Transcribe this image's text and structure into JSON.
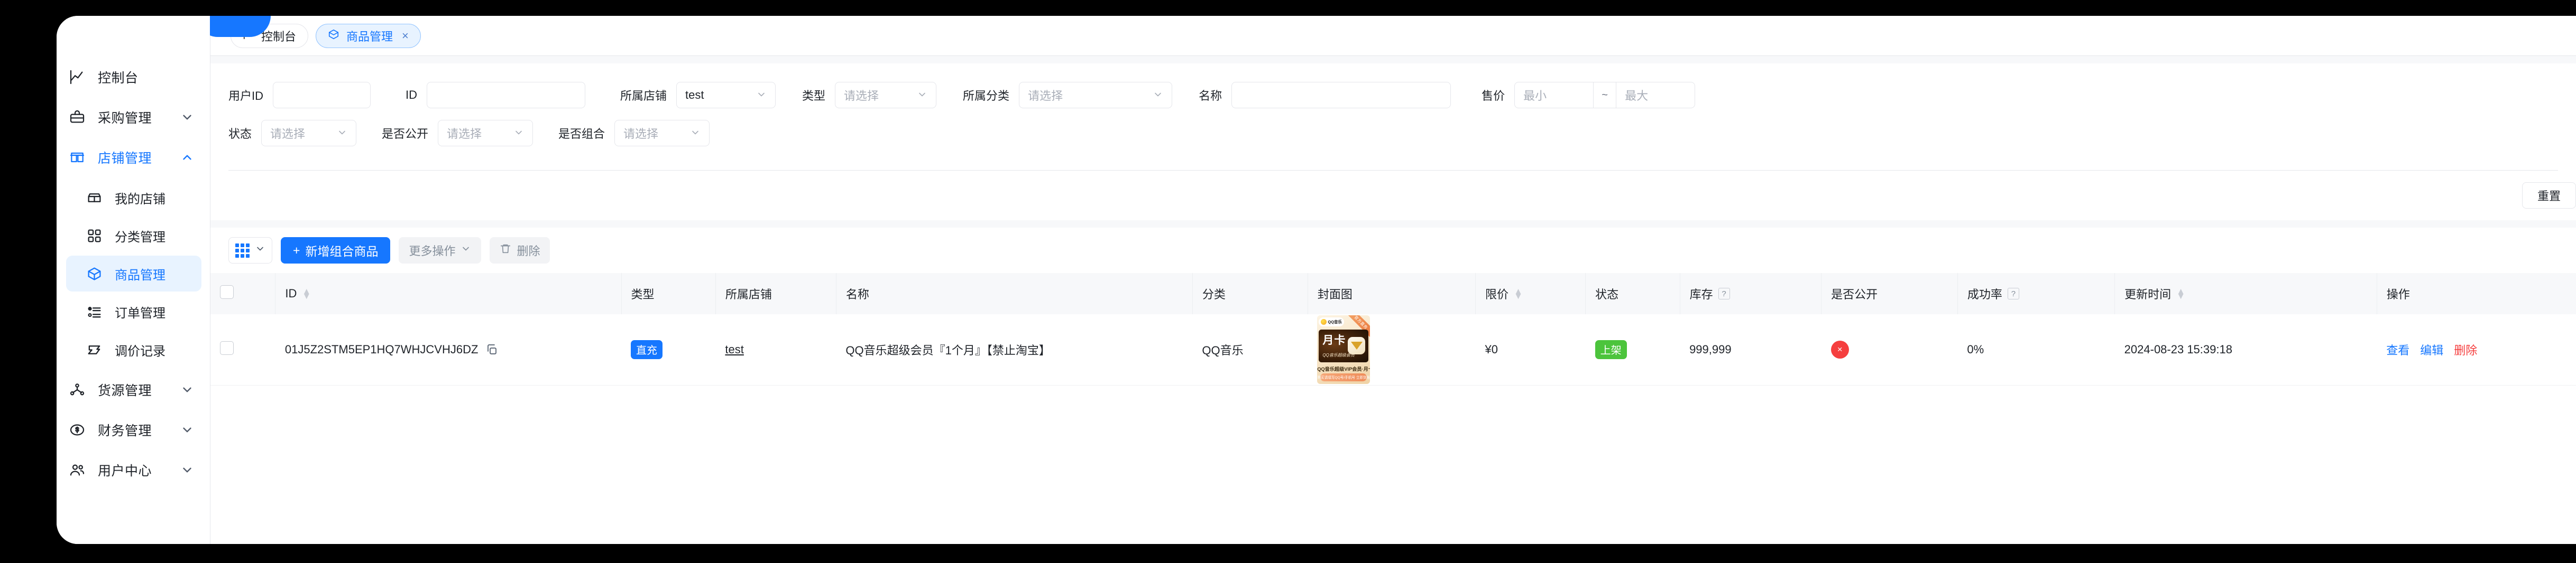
{
  "theme": {
    "primary": "#1677ff",
    "success": "#4cc43c",
    "danger": "#f53f3f",
    "tab_active_bg": "#e8f3ff",
    "page_bg": "#f7f8fa"
  },
  "sidebar": {
    "items": [
      {
        "label": "控制台",
        "icon": "chart-line-icon",
        "expandable": false,
        "active": false
      },
      {
        "label": "采购管理",
        "icon": "briefcase-icon",
        "expandable": true,
        "expanded": false,
        "active": false
      },
      {
        "label": "店铺管理",
        "icon": "shop-icon",
        "expandable": true,
        "expanded": true,
        "active": true
      },
      {
        "label": "货源管理",
        "icon": "share-nodes-icon",
        "expandable": true,
        "expanded": false,
        "active": false
      },
      {
        "label": "财务管理",
        "icon": "dollar-circle-icon",
        "expandable": true,
        "expanded": false,
        "active": false
      },
      {
        "label": "用户中心",
        "icon": "users-icon",
        "expandable": true,
        "expanded": false,
        "active": false
      }
    ],
    "sub_items": [
      {
        "label": "我的店铺",
        "icon": "storefront-icon",
        "selected": false
      },
      {
        "label": "分类管理",
        "icon": "category-grid-icon",
        "selected": false
      },
      {
        "label": "商品管理",
        "icon": "box-icon",
        "selected": true
      },
      {
        "label": "订单管理",
        "icon": "list-icon",
        "selected": false
      },
      {
        "label": "调价记录",
        "icon": "price-tag-icon",
        "selected": false
      }
    ]
  },
  "tabs": [
    {
      "label": "控制台",
      "icon": "chart-line-icon",
      "active": false,
      "closable": false
    },
    {
      "label": "商品管理",
      "icon": "box-icon",
      "active": true,
      "closable": true,
      "close_glyph": "×"
    }
  ],
  "filters": {
    "row1": [
      {
        "label": "用户ID",
        "type": "input",
        "value": "",
        "placeholder": ""
      },
      {
        "label": "ID",
        "type": "input",
        "value": "",
        "placeholder": ""
      },
      {
        "label": "所属店铺",
        "type": "select",
        "value": "test",
        "placeholder": ""
      },
      {
        "label": "类型",
        "type": "select",
        "value": "",
        "placeholder": "请选择"
      },
      {
        "label": "所属分类",
        "type": "select",
        "value": "",
        "placeholder": "请选择"
      },
      {
        "label": "名称",
        "type": "input",
        "value": "",
        "placeholder": ""
      }
    ],
    "price_range": {
      "label": "售价",
      "min_placeholder": "最小",
      "max_placeholder": "最大",
      "separator": "~"
    },
    "row2": [
      {
        "label": "状态",
        "type": "select",
        "value": "",
        "placeholder": "请选择"
      },
      {
        "label": "是否公开",
        "type": "select",
        "value": "",
        "placeholder": "请选择"
      },
      {
        "label": "是否组合",
        "type": "select",
        "value": "",
        "placeholder": "请选择"
      }
    ],
    "reset_button": "重置"
  },
  "toolbar": {
    "columns_icon": "grid-columns-icon",
    "add_button": "新增组合商品",
    "add_prefix": "+",
    "more_button": "更多操作",
    "delete_button": "删除",
    "delete_icon": "trash-icon"
  },
  "table": {
    "columns": [
      {
        "key": "checkbox",
        "label": "",
        "sortable": false,
        "help": false
      },
      {
        "key": "id",
        "label": "ID",
        "sortable": true,
        "help": false
      },
      {
        "key": "type",
        "label": "类型",
        "sortable": false,
        "help": false
      },
      {
        "key": "shop",
        "label": "所属店铺",
        "sortable": false,
        "help": false
      },
      {
        "key": "name",
        "label": "名称",
        "sortable": false,
        "help": false
      },
      {
        "key": "category",
        "label": "分类",
        "sortable": false,
        "help": false
      },
      {
        "key": "cover",
        "label": "封面图",
        "sortable": false,
        "help": false
      },
      {
        "key": "limit_price",
        "label": "限价",
        "sortable": true,
        "help": false
      },
      {
        "key": "status",
        "label": "状态",
        "sortable": false,
        "help": false
      },
      {
        "key": "stock",
        "label": "库存",
        "sortable": false,
        "help": true
      },
      {
        "key": "public",
        "label": "是否公开",
        "sortable": false,
        "help": false
      },
      {
        "key": "success_rate",
        "label": "成功率",
        "sortable": false,
        "help": true
      },
      {
        "key": "updated_at",
        "label": "更新时间",
        "sortable": true,
        "help": false
      },
      {
        "key": "ops",
        "label": "操作",
        "sortable": false,
        "help": false
      }
    ],
    "help_glyph": "?",
    "rows": [
      {
        "id": "01J5Z2STM5EP1HQ7WHJCVHJ6DZ",
        "copy_icon": "copy-icon",
        "type": "直充",
        "shop": "test",
        "name": "QQ音乐超级会员『1个月』【禁止淘宝】",
        "category": "QQ音乐",
        "cover": {
          "brand": "QQ音乐",
          "ribbon": "官方直充",
          "headline": "月卡",
          "sub": "QQ音乐超级会员",
          "title": "QQ音乐超级VIP会员·月卡",
          "note": "购买请填写QQ号/手机号 立即到账"
        },
        "limit_price": "¥0",
        "status": "上架",
        "stock": "999,999",
        "public": "否",
        "public_glyph": "×",
        "success_rate": "0%",
        "updated_at": "2024-08-23 15:39:18",
        "ops": [
          {
            "label": "查看",
            "kind": "link"
          },
          {
            "label": "编辑",
            "kind": "link"
          },
          {
            "label": "删除",
            "kind": "danger"
          }
        ]
      }
    ]
  }
}
